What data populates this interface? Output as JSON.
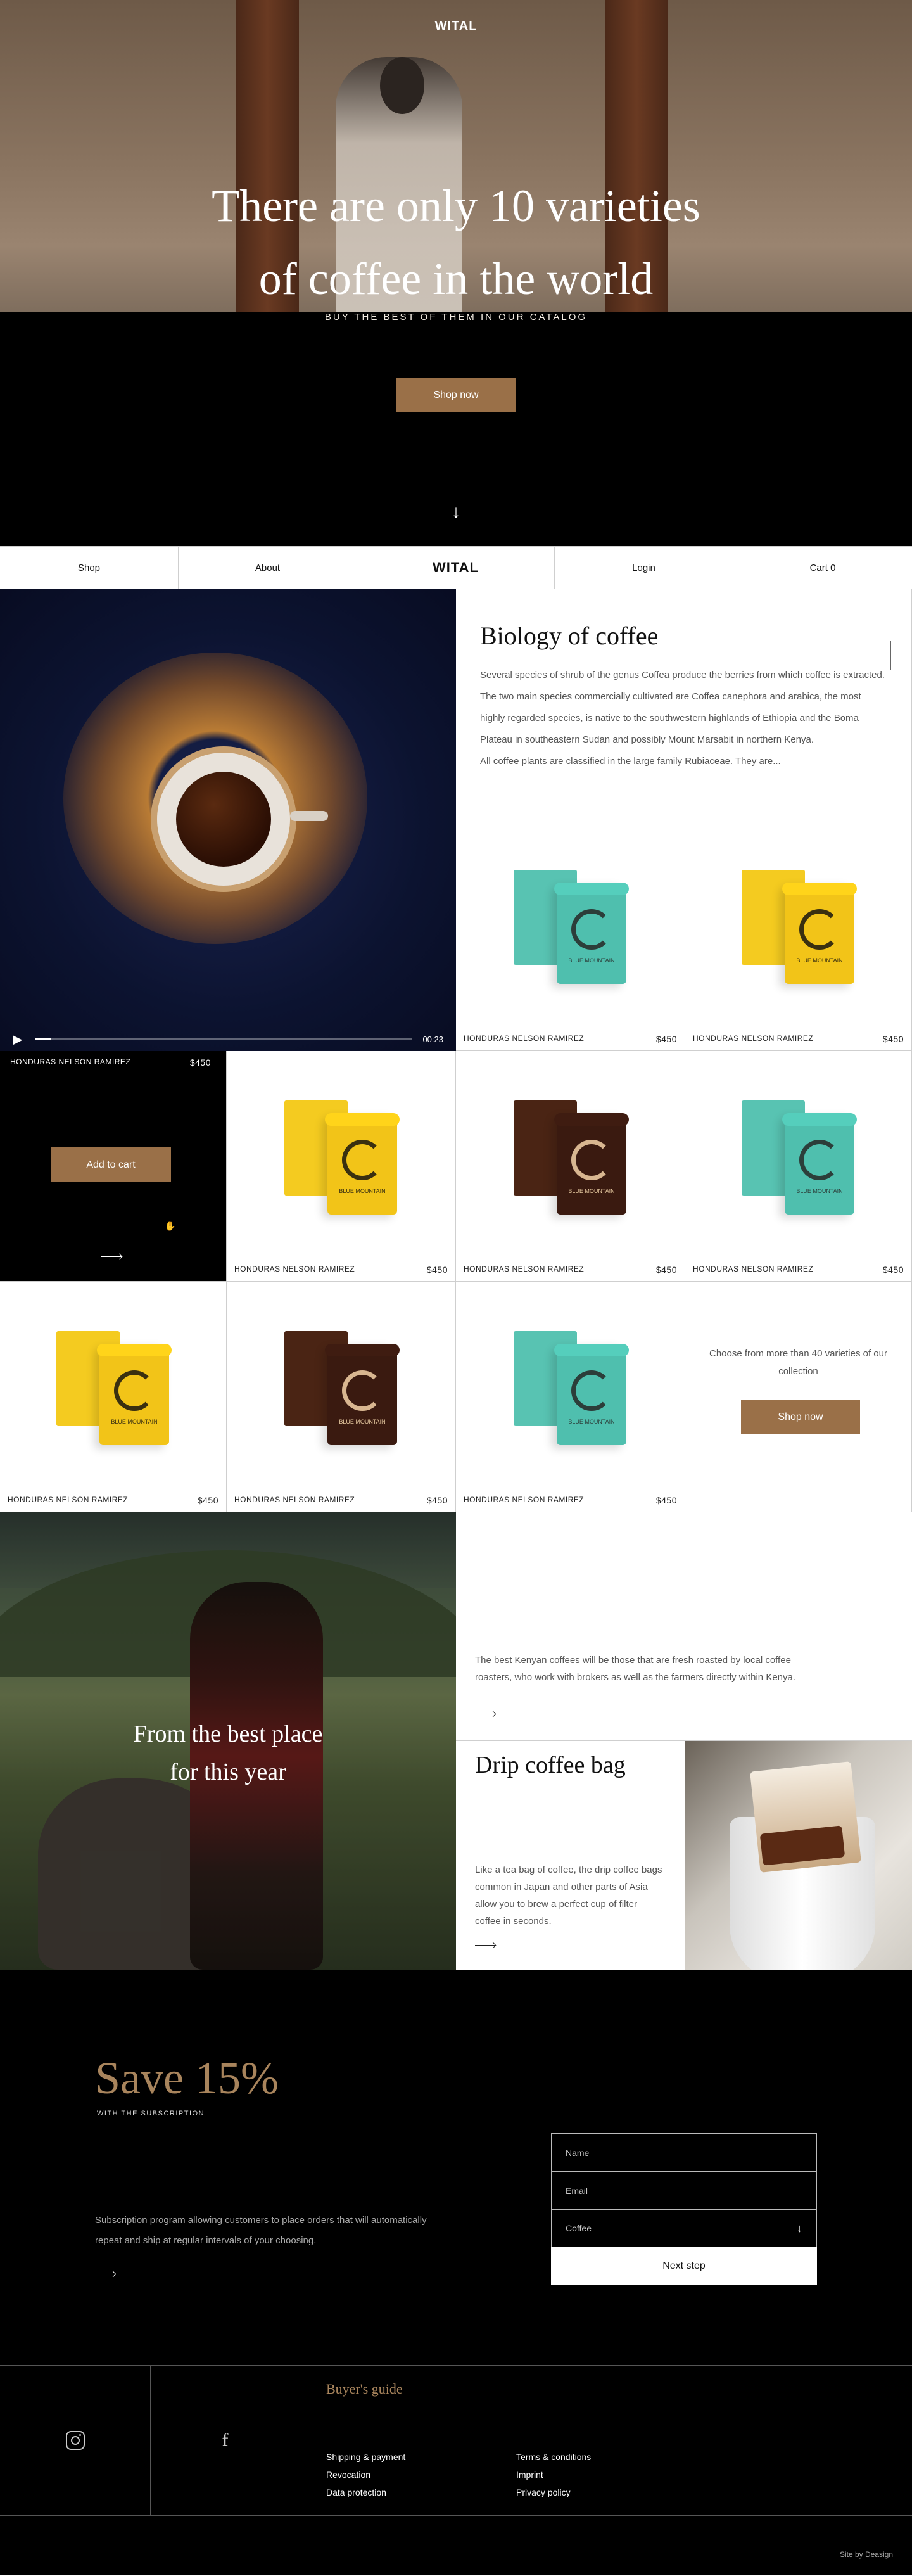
{
  "hero": {
    "brand": "WITAL",
    "title_line1": "There are only 10 varieties",
    "title_line2": "of coffee in the world",
    "subtitle": "BUY THE BEST OF THEM IN OUR CATALOG",
    "cta": "Shop now",
    "scroll_icon": "arrow-down-icon"
  },
  "nav": {
    "shop": "Shop",
    "about": "About",
    "logo": "WITAL",
    "login": "Login",
    "cart": "Cart 0"
  },
  "video": {
    "play_icon": "play-icon",
    "time": "00:23",
    "progress": 0.04
  },
  "biology": {
    "title": "Biology of coffee",
    "p1": "Several species of shrub of the genus Coffea produce the berries from which coffee is extracted. The two main species commercially cultivated are Coffea canephora and arabica, the most highly regarded species, is native to the southwestern highlands of Ethiopia and the Boma Plateau in southeastern Sudan and possibly Mount Marsabit in northern Kenya.",
    "p2": "All coffee plants are classified in the large family Rubiaceae. They are..."
  },
  "products": [
    {
      "name": "HONDURAS NELSON RAMIREZ",
      "price": "$450",
      "color": "teal"
    },
    {
      "name": "HONDURAS NELSON RAMIREZ",
      "price": "$450",
      "color": "yellow"
    },
    {
      "name": "HONDURAS NELSON RAMIREZ",
      "price": "$450",
      "color": "black",
      "cta": "Add to cart"
    },
    {
      "name": "HONDURAS NELSON RAMIREZ",
      "price": "$450",
      "color": "yellow"
    },
    {
      "name": "HONDURAS NELSON RAMIREZ",
      "price": "$450",
      "color": "brown"
    },
    {
      "name": "HONDURAS NELSON RAMIREZ",
      "price": "$450",
      "color": "teal"
    },
    {
      "name": "HONDURAS NELSON RAMIREZ",
      "price": "$450",
      "color": "yellow"
    },
    {
      "name": "HONDURAS NELSON RAMIREZ",
      "price": "$450",
      "color": "brown"
    },
    {
      "name": "HONDURAS NELSON RAMIREZ",
      "price": "$450",
      "color": "teal"
    }
  ],
  "tin_label": "BLUE MOUNTAIN",
  "collection": {
    "text": "Choose from more than 40 varieties of our collection",
    "cta": "Shop now"
  },
  "story": {
    "caption_line1": "From the best place",
    "caption_line2": "for this year",
    "kenya_text": "The best Kenyan coffees will be those that are fresh roasted by local coffee roasters, who work with brokers as well as the farmers directly within Kenya.",
    "drip_title": "Drip coffee bag",
    "drip_text": "Like a tea bag of coffee, the drip coffee bags common in Japan and other parts of Asia allow you to brew a perfect cup of filter coffee in seconds."
  },
  "subscribe": {
    "title": "Save 15%",
    "with": "WITH THE SUBSCRIPTION",
    "desc": "Subscription program allowing customers to place orders that will automatically repeat and ship at regular intervals of your choosing.",
    "name_placeholder": "Name",
    "email_placeholder": "Email",
    "coffee_value": "Coffee",
    "next": "Next step"
  },
  "footer": {
    "guide_title": "Buyer's guide",
    "links_left": [
      "Shipping & payment",
      "Revocation",
      "Data protection"
    ],
    "links_right": [
      "Terms & conditions",
      "Imprint",
      "Privacy policy"
    ],
    "credit": "Site by Deasign"
  },
  "colors": {
    "accent": "#9a7048",
    "gold_text": "#a8845c",
    "teal": "#4fbfae",
    "yellow": "#f2c418",
    "brown": "#3a1a10"
  }
}
